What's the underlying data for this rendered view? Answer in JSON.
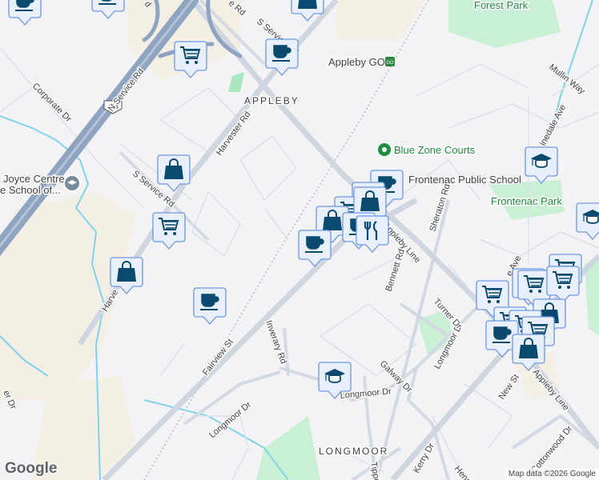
{
  "map": {
    "areas": {
      "appleby": "APPLEBY",
      "longmoor": "LONGMOOR"
    },
    "parks": {
      "forest_park": "Forest Park",
      "frontenac_park": "Frontenac Park"
    },
    "pois": {
      "appleby_go": "Appleby GO",
      "blue_zone": "Blue Zone Courts",
      "frontenac_school": "Frontenac Public School",
      "joyce_line1": "Joyce Centre",
      "joyce_line2": "e School of..."
    },
    "highway_shield": "403",
    "roads": {
      "n_service": "N Service Rd",
      "s_service_top": "S Service Rd",
      "s_service_mid": "S Service Rd",
      "harvester_top": "Harvester Rd",
      "harvester_bottom": "Harve",
      "corporate": "Corporate Dr",
      "fairview": "Fairview St",
      "inverary": "Inverary Rd",
      "longmoor_w": "Longmoor Dr",
      "longmoor_mid": "Longmoor Dr",
      "longmoor_e": "Longmoor Dr",
      "appleby_line_n": "Appleby Line",
      "appleby_line_s": "Appleby Line",
      "bennett": "Bennett Rd",
      "sheraton": "Sheraton Rd",
      "turner": "Turner Dr",
      "galway": "Galway Dr",
      "kerry": "Kerry Dr",
      "tipper": "Tipper",
      "hend": "Hend",
      "cottonwood": "Cottonwood Dr",
      "new_st": "New St",
      "mullin": "Mullin Way",
      "pinedale": "inedale Ave",
      "pinedale_s": "e Ave",
      "top_rd": "e Rd",
      "top_rd2": "d",
      "er_dr": "er Dr"
    },
    "logo": "Google",
    "attribution": "Map data ©2026 Google",
    "colors": {
      "marker_fill": "#e8efff",
      "marker_border": "#6f96e6",
      "icon": "#0b4a6f",
      "highway": "#8fa4c0",
      "park": "#c9efd5",
      "water": "#7fd3ea"
    }
  }
}
